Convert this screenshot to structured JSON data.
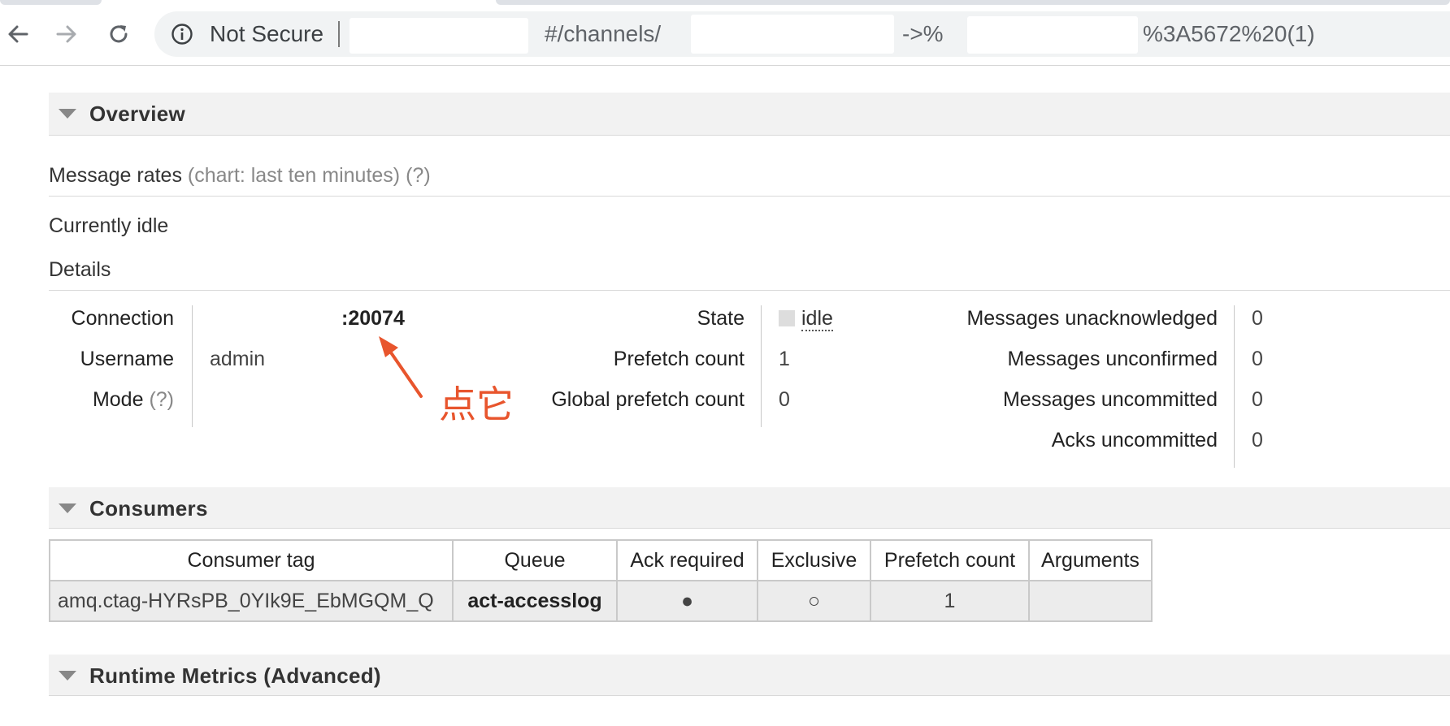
{
  "browser": {
    "security_label": "Not Secure",
    "url_fragment_1": "#/channels/",
    "url_fragment_2": "->%",
    "url_fragment_3": "%3A5672%20(1)"
  },
  "overview": {
    "title": "Overview",
    "message_rates_label": "Message rates",
    "message_rates_hint": "(chart: last ten minutes)",
    "help_hint": "(?)",
    "idle_text": "Currently idle",
    "details_label": "Details"
  },
  "details": {
    "connection_label": "Connection",
    "connection_value": ":20074",
    "username_label": "Username",
    "username_value": "admin",
    "mode_label": "Mode",
    "mode_help": "(?)",
    "state_label": "State",
    "state_value": "idle",
    "prefetch_label": "Prefetch count",
    "prefetch_value": "1",
    "global_prefetch_label": "Global prefetch count",
    "global_prefetch_value": "0",
    "unacked_label": "Messages unacknowledged",
    "unacked_value": "0",
    "unconfirmed_label": "Messages unconfirmed",
    "unconfirmed_value": "0",
    "uncommitted_label": "Messages uncommitted",
    "uncommitted_value": "0",
    "acks_uncommitted_label": "Acks uncommitted",
    "acks_uncommitted_value": "0"
  },
  "annotation": {
    "text": "点它",
    "color": "#e8552d"
  },
  "consumers": {
    "title": "Consumers",
    "headers": [
      "Consumer tag",
      "Queue",
      "Ack required",
      "Exclusive",
      "Prefetch count",
      "Arguments"
    ],
    "rows": [
      {
        "tag": "amq.ctag-HYRsPB_0YIk9E_EbMGQM_Q",
        "queue": "act-accesslog",
        "ack_required": "●",
        "exclusive": "○",
        "prefetch": "1",
        "arguments": ""
      }
    ]
  },
  "runtime": {
    "title": "Runtime Metrics (Advanced)"
  },
  "icons": {
    "back": "arrow-left-icon",
    "forward": "arrow-right-icon",
    "reload": "reload-icon",
    "info": "info-icon"
  }
}
